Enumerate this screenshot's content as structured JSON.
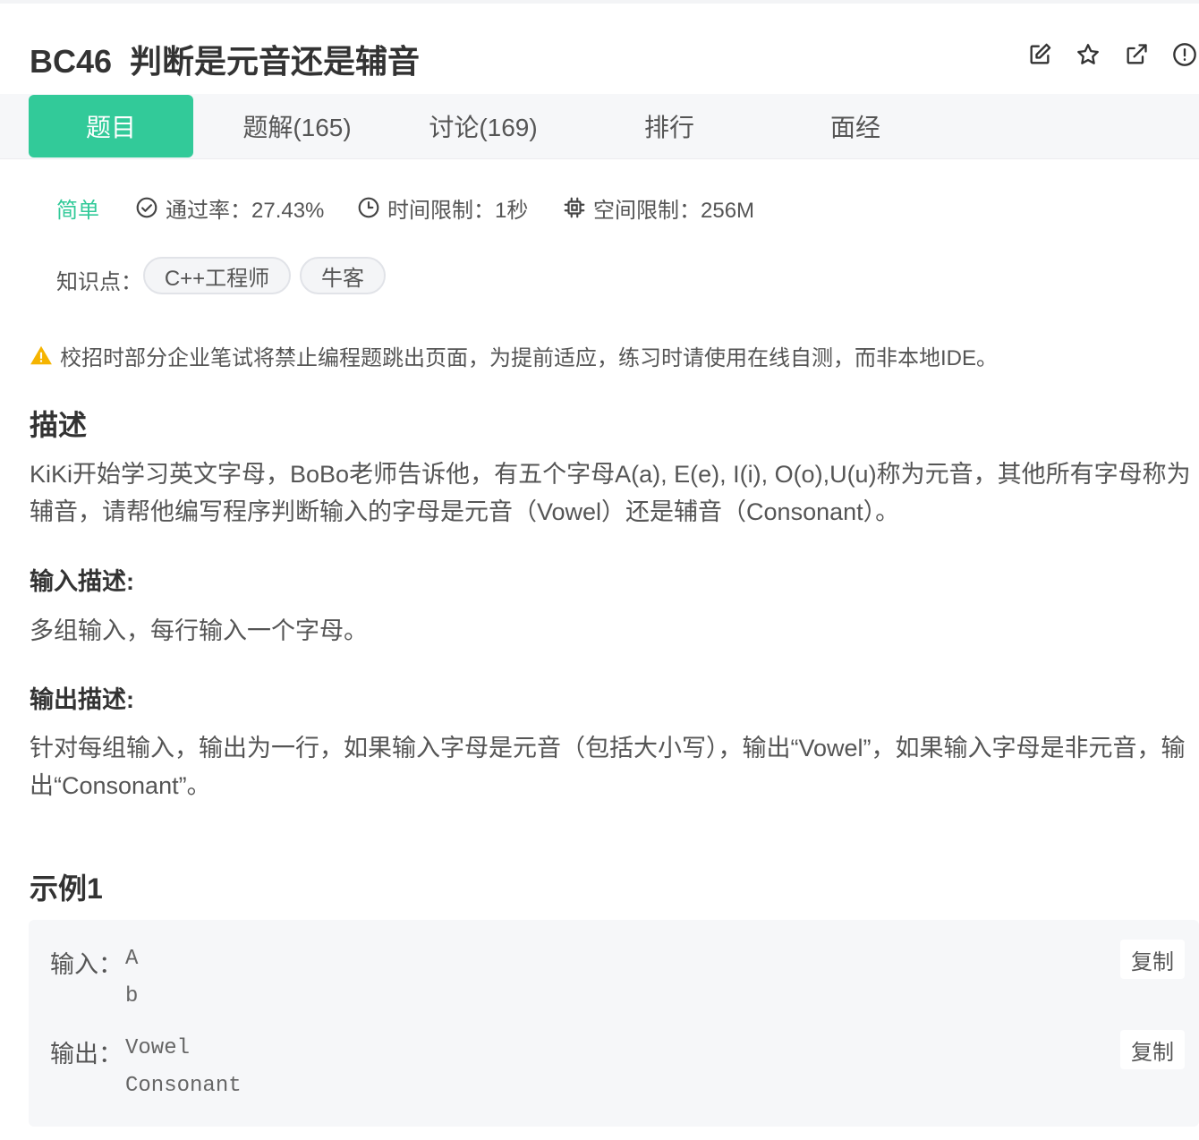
{
  "problem": {
    "id": "BC46",
    "name": "判断是元音还是辅音"
  },
  "header_icons": [
    {
      "name": "edit-icon"
    },
    {
      "name": "star-icon"
    },
    {
      "name": "share-icon"
    },
    {
      "name": "report-icon"
    }
  ],
  "tabs": [
    {
      "label": "题目",
      "active": true
    },
    {
      "label": "题解(165)"
    },
    {
      "label": "讨论(169)"
    },
    {
      "label": "排行"
    },
    {
      "label": "面经"
    }
  ],
  "meta": {
    "difficulty": "简单",
    "pass_rate": "通过率：27.43%",
    "time_limit": "时间限制：1秒",
    "space_limit": "空间限制：256M"
  },
  "knowledge": {
    "label": "知识点：",
    "tags": [
      "C++工程师",
      "牛客"
    ]
  },
  "warning": "校招时部分企业笔试将禁止编程题跳出页面，为提前适应，练习时请使用在线自测，而非本地IDE。",
  "description": {
    "heading": "描述",
    "text": "KiKi开始学习英文字母，BoBo老师告诉他，有五个字母A(a), E(e), I(i), O(o),U(u)称为元音，其他所有字母称为辅音，请帮他编写程序判断输入的字母是元音（Vowel）还是辅音（Consonant）。"
  },
  "input_desc": {
    "heading": "输入描述:",
    "text": "多组输入，每行输入一个字母。"
  },
  "output_desc": {
    "heading": "输出描述:",
    "text": "针对每组输入，输出为一行，如果输入字母是元音（包括大小写），输出“Vowel”，如果输入字母是非元音，输出“Consonant”。"
  },
  "example": {
    "heading": "示例1",
    "input_label": "输入：",
    "input_value": "A\nb",
    "output_label": "输出：",
    "output_value": "Vowel\nConsonant",
    "copy_label": "复制"
  },
  "colors": {
    "accent": "#32ca99",
    "warning": "#f5b400"
  }
}
